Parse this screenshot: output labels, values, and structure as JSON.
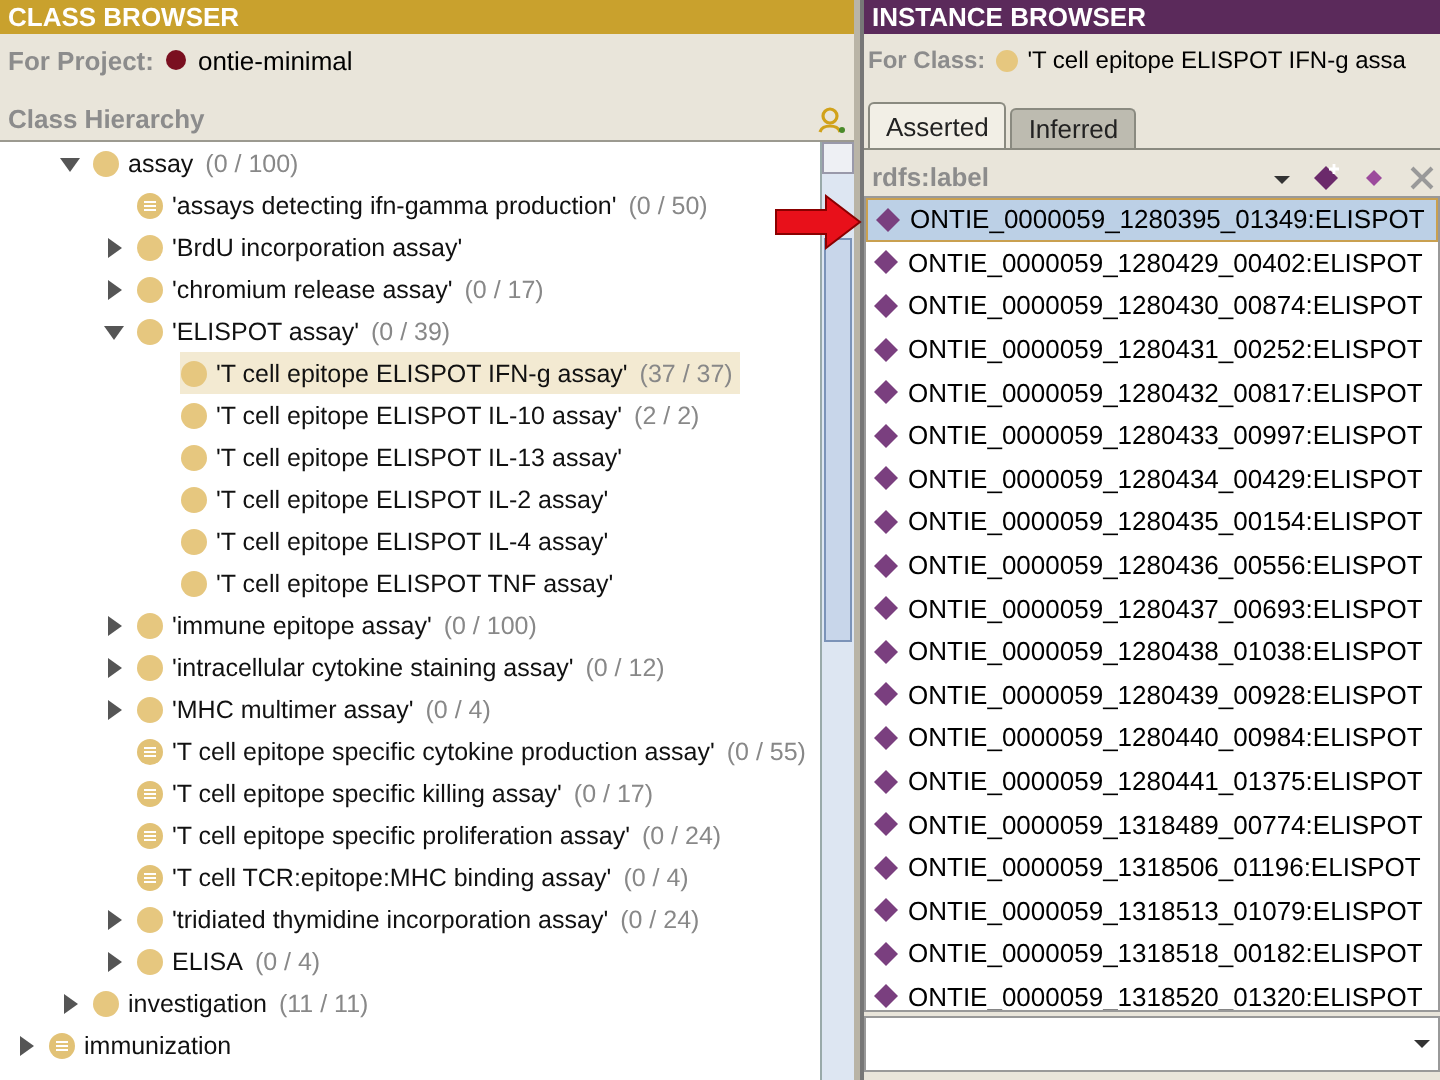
{
  "class_browser": {
    "title": "CLASS BROWSER",
    "project_label": "For Project:",
    "project_name": "ontie-minimal",
    "hierarchy_title": "Class Hierarchy",
    "tree": [
      {
        "label": "assay",
        "count": "(0 / 100)",
        "kind": "primitive",
        "expanded": true,
        "selected": false,
        "children": [
          {
            "label": "'assays detecting ifn-gamma production'",
            "count": "(0 / 50)",
            "kind": "defined",
            "selected": false
          },
          {
            "label": "'BrdU incorporation assay'",
            "kind": "primitive",
            "expanded": false,
            "selected": false
          },
          {
            "label": "'chromium release assay'",
            "count": "(0 / 17)",
            "kind": "primitive",
            "expanded": false,
            "selected": false
          },
          {
            "label": "'ELISPOT assay'",
            "count": "(0 / 39)",
            "kind": "primitive",
            "expanded": true,
            "selected": false,
            "children": [
              {
                "label": "'T cell epitope ELISPOT IFN-g assay'",
                "count": "(37 / 37)",
                "kind": "primitive",
                "selected": true
              },
              {
                "label": "'T cell epitope ELISPOT IL-10 assay'",
                "count": "(2 / 2)",
                "kind": "primitive",
                "selected": false
              },
              {
                "label": "'T cell epitope ELISPOT IL-13 assay'",
                "kind": "primitive",
                "selected": false
              },
              {
                "label": "'T cell epitope ELISPOT IL-2 assay'",
                "kind": "primitive",
                "selected": false
              },
              {
                "label": "'T cell epitope ELISPOT IL-4 assay'",
                "kind": "primitive",
                "selected": false
              },
              {
                "label": "'T cell epitope ELISPOT TNF assay'",
                "kind": "primitive",
                "selected": false
              }
            ]
          },
          {
            "label": "'immune epitope assay'",
            "count": "(0 / 100)",
            "kind": "primitive",
            "expanded": false,
            "selected": false
          },
          {
            "label": "'intracellular cytokine staining assay'",
            "count": "(0 / 12)",
            "kind": "primitive",
            "expanded": false,
            "selected": false
          },
          {
            "label": "'MHC multimer assay'",
            "count": "(0 / 4)",
            "kind": "primitive",
            "expanded": false,
            "selected": false
          },
          {
            "label": "'T cell epitope specific cytokine production assay'",
            "count": "(0 / 55)",
            "kind": "defined",
            "selected": false
          },
          {
            "label": "'T cell epitope specific killing assay'",
            "count": "(0 / 17)",
            "kind": "defined",
            "selected": false
          },
          {
            "label": "'T cell epitope specific proliferation assay'",
            "count": "(0 / 24)",
            "kind": "defined",
            "selected": false
          },
          {
            "label": "'T cell TCR:epitope:MHC binding assay'",
            "count": "(0 / 4)",
            "kind": "defined",
            "selected": false
          },
          {
            "label": "'tridiated thymidine incorporation assay'",
            "count": "(0 / 24)",
            "kind": "primitive",
            "expanded": false,
            "selected": false
          },
          {
            "label": "ELISA",
            "count": "(0 / 4)",
            "kind": "primitive",
            "expanded": false,
            "selected": false
          }
        ]
      },
      {
        "label": "investigation",
        "count": "(11 / 11)",
        "kind": "primitive",
        "expanded": false,
        "selected": false
      }
    ],
    "parent_level_items": [
      {
        "label": "immunization",
        "kind": "defined",
        "expanded": false,
        "selected": false
      }
    ]
  },
  "instance_browser": {
    "title": "INSTANCE BROWSER",
    "class_label": "For Class:",
    "class_name": "'T cell epitope ELISPOT IFN-g assa",
    "tabs": [
      {
        "label": "Asserted",
        "selected": true
      },
      {
        "label": "Inferred",
        "selected": false
      }
    ],
    "list_header": "rdfs:label",
    "instances": [
      {
        "label": "ONTIE_0000059_1280395_01349:ELISPOT",
        "selected": true
      },
      {
        "label": "ONTIE_0000059_1280429_00402:ELISPOT",
        "selected": false
      },
      {
        "label": "ONTIE_0000059_1280430_00874:ELISPOT",
        "selected": false
      },
      {
        "label": "ONTIE_0000059_1280431_00252:ELISPOT",
        "selected": false
      },
      {
        "label": "ONTIE_0000059_1280432_00817:ELISPOT",
        "selected": false
      },
      {
        "label": "ONTIE_0000059_1280433_00997:ELISPOT",
        "selected": false
      },
      {
        "label": "ONTIE_0000059_1280434_00429:ELISPOT",
        "selected": false
      },
      {
        "label": "ONTIE_0000059_1280435_00154:ELISPOT",
        "selected": false
      },
      {
        "label": "ONTIE_0000059_1280436_00556:ELISPOT",
        "selected": false
      },
      {
        "label": "ONTIE_0000059_1280437_00693:ELISPOT",
        "selected": false
      },
      {
        "label": "ONTIE_0000059_1280438_01038:ELISPOT",
        "selected": false
      },
      {
        "label": "ONTIE_0000059_1280439_00928:ELISPOT",
        "selected": false
      },
      {
        "label": "ONTIE_0000059_1280440_00984:ELISPOT",
        "selected": false
      },
      {
        "label": "ONTIE_0000059_1280441_01375:ELISPOT",
        "selected": false
      },
      {
        "label": "ONTIE_0000059_1318489_00774:ELISPOT",
        "selected": false
      },
      {
        "label": "ONTIE_0000059_1318506_01196:ELISPOT",
        "selected": false
      },
      {
        "label": "ONTIE_0000059_1318513_01079:ELISPOT",
        "selected": false
      },
      {
        "label": "ONTIE_0000059_1318518_00182:ELISPOT",
        "selected": false
      },
      {
        "label": "ONTIE_0000059_1318520_01320:ELISPOT",
        "selected": false
      }
    ]
  }
}
